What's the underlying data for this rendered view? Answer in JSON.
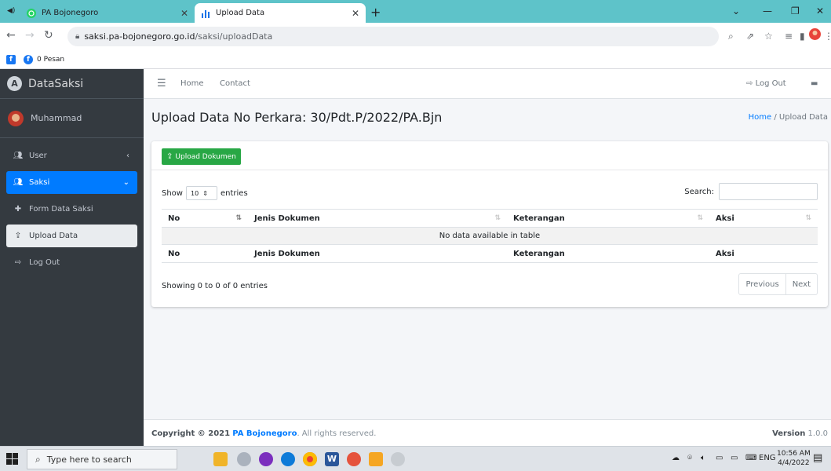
{
  "browser": {
    "tabs": [
      {
        "title": "PA Bojonegoro",
        "active": false,
        "icon": "whatsapp-icon"
      },
      {
        "title": "Upload Data",
        "active": true,
        "icon": "chart-bars-icon"
      }
    ],
    "url_domain": "saksi.pa-bojonegoro.go.id",
    "url_path": "/saksi/uploadData",
    "bookmark": "0 Pesan"
  },
  "sidebar": {
    "brand": "DataSaksi",
    "user_name": "Muhammad",
    "items": [
      {
        "label": "User",
        "icon": "users-icon"
      },
      {
        "label": "Saksi",
        "icon": "users-icon"
      },
      {
        "label": "Form Data Saksi",
        "icon": "plus-icon"
      },
      {
        "label": "Upload Data",
        "icon": "upload-icon"
      },
      {
        "label": "Log Out",
        "icon": "sign-out-icon"
      }
    ]
  },
  "topnav": {
    "home": "Home",
    "contact": "Contact",
    "logout": "Log Out"
  },
  "page": {
    "title": "Upload Data No Perkara: 30/Pdt.P/2022/PA.Bjn",
    "breadcrumb_home": "Home",
    "breadcrumb_sep": "/",
    "breadcrumb_current": "Upload Data"
  },
  "card": {
    "upload_button": "Upload Dokumen",
    "show_label": "Show",
    "entries_label": "entries",
    "length_value": "10",
    "search_label": "Search:",
    "columns": [
      "No",
      "Jenis Dokumen",
      "Keterangan",
      "Aksi"
    ],
    "empty_message": "No data available in table",
    "info": "Showing 0 to 0 of 0 entries",
    "prev": "Previous",
    "next": "Next"
  },
  "footer": {
    "copyright_prefix": "Copyright © 2021",
    "org": "PA Bojonegoro",
    "rights": ". All rights reserved.",
    "version_label": "Version",
    "version": "1.0.0"
  },
  "taskbar": {
    "search_placeholder": "Type here to search",
    "lang": "ENG",
    "time": "10:56 AM",
    "date": "4/4/2022"
  },
  "colors": {
    "accent": "#007bff",
    "success": "#28a745",
    "sidebar": "#343a40"
  }
}
